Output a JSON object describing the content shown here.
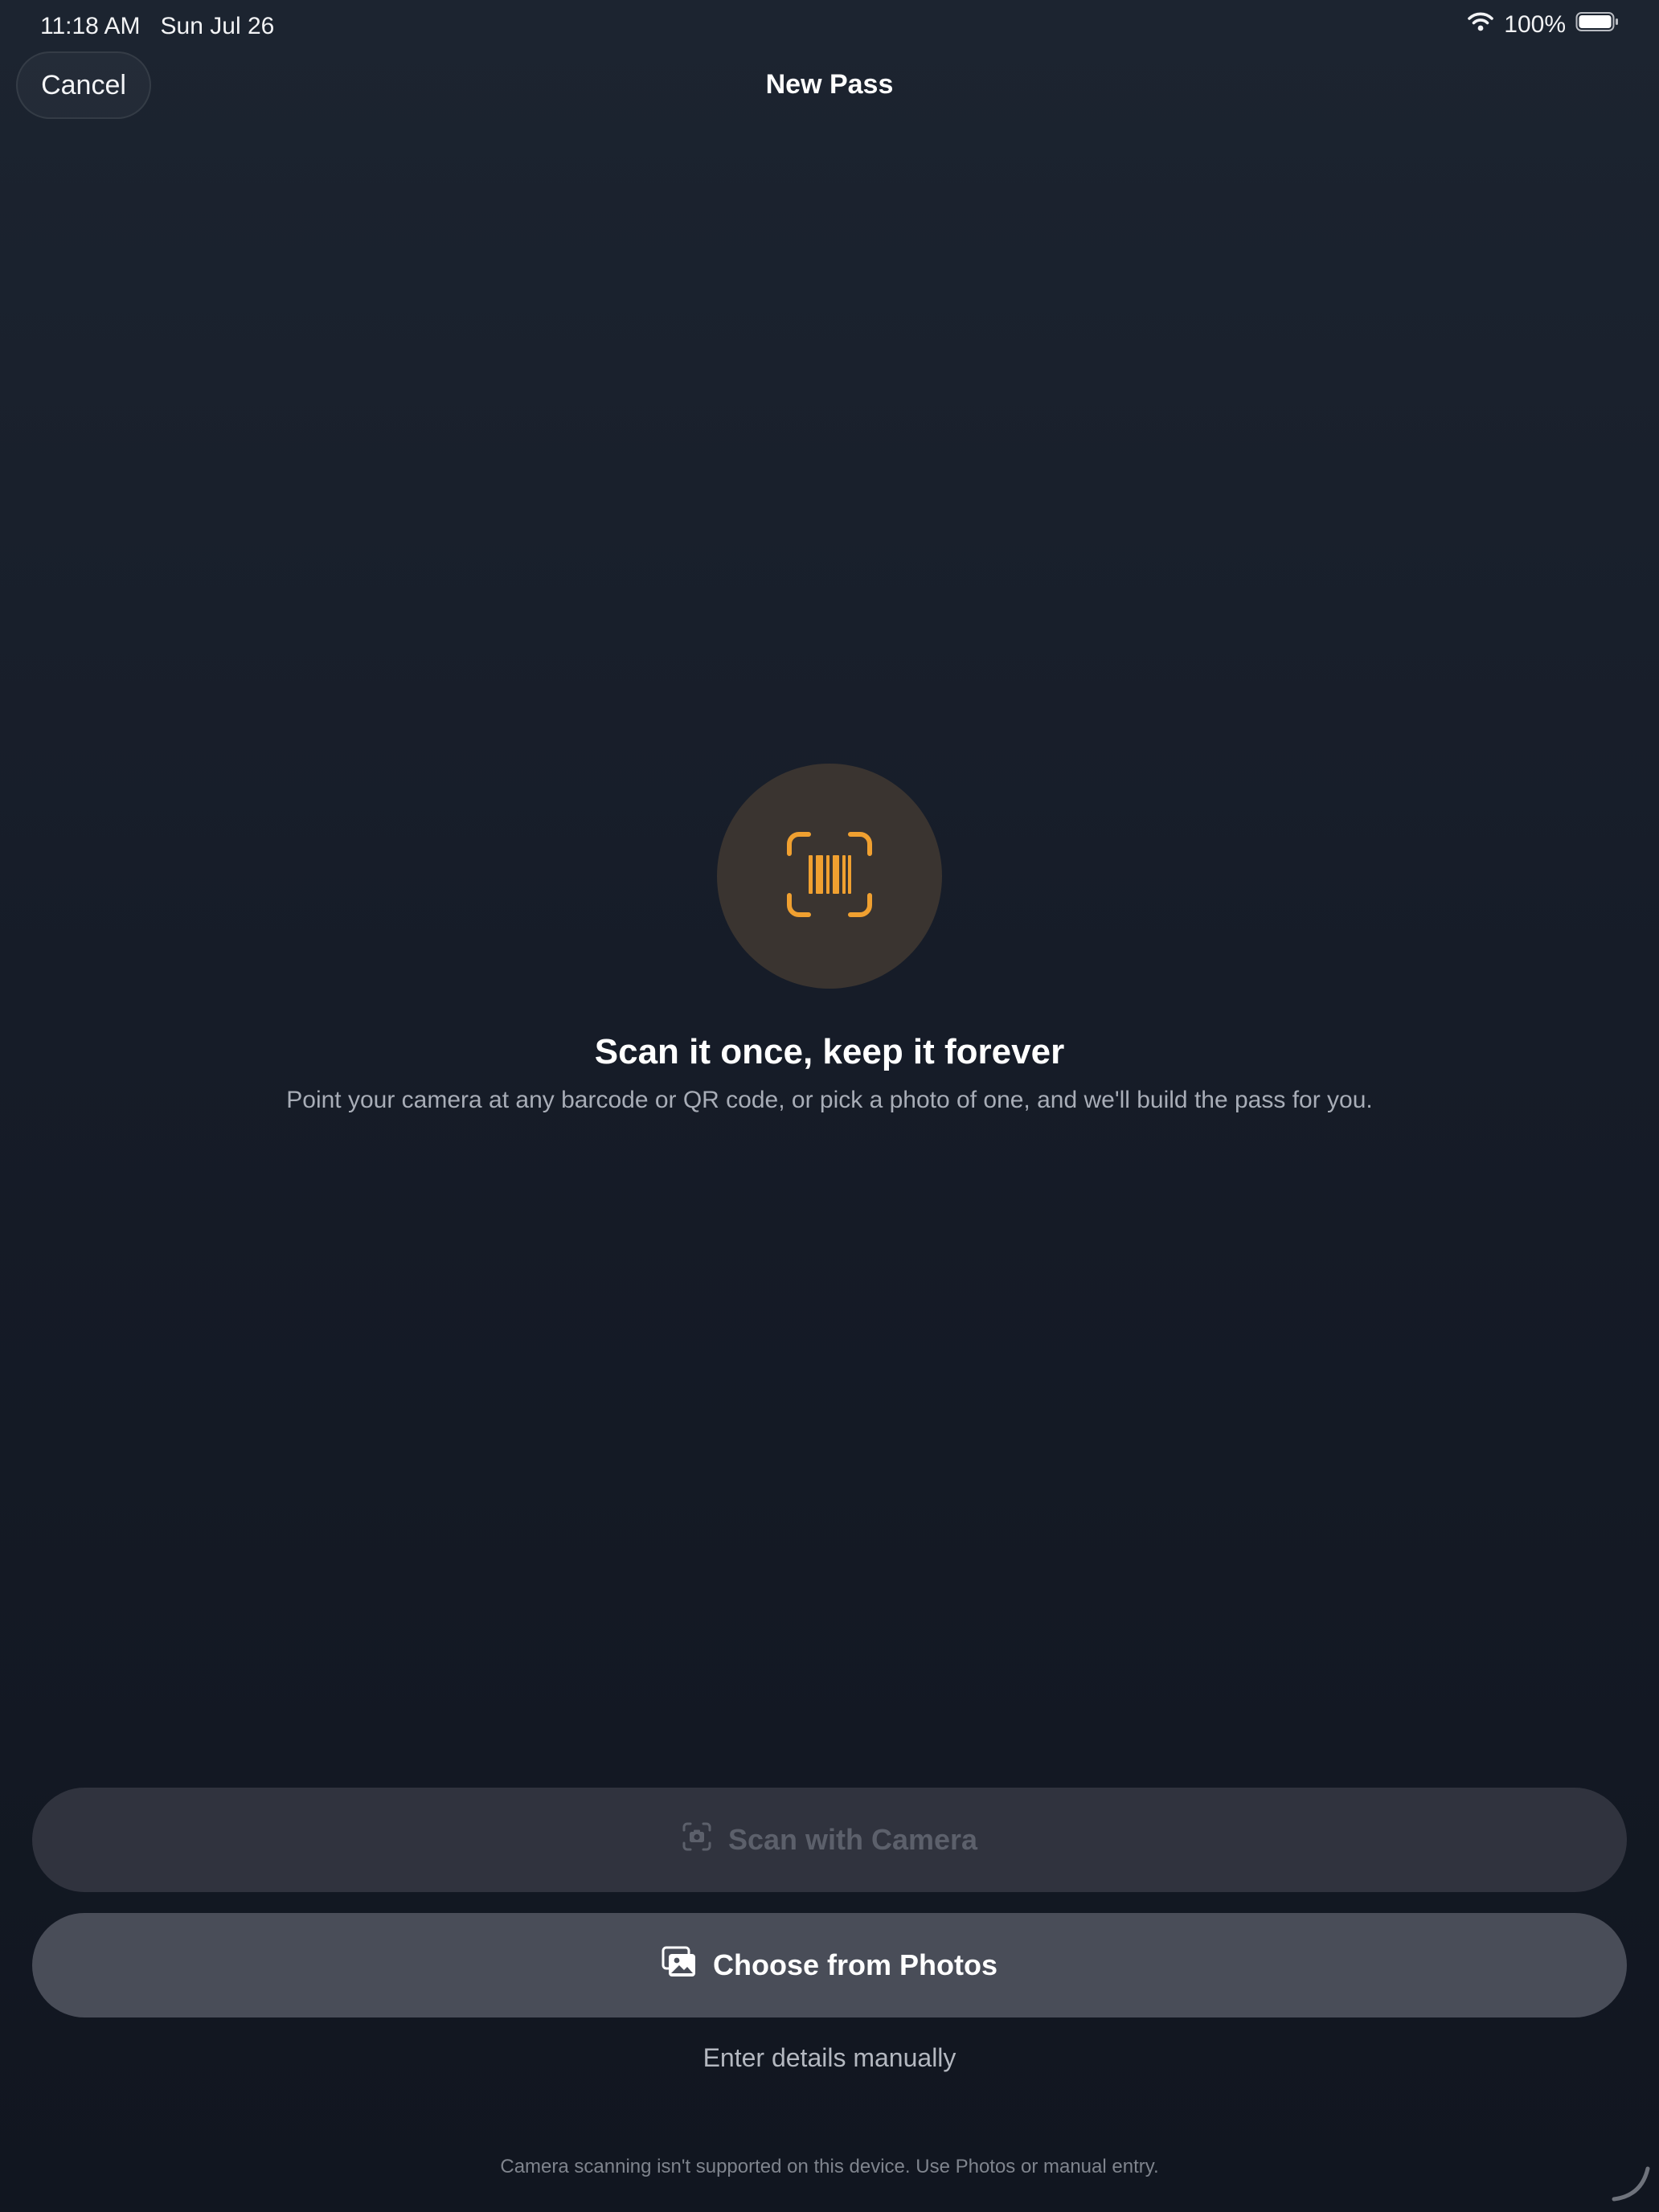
{
  "status_bar": {
    "time": "11:18 AM",
    "date": "Sun Jul 26",
    "battery_percent": "100%",
    "icons": [
      "wifi-icon",
      "battery-icon"
    ]
  },
  "nav": {
    "cancel_label": "Cancel",
    "title": "New Pass"
  },
  "hero": {
    "icon": "barcode-scan-icon",
    "title": "Scan it once, keep it forever",
    "subtitle": "Point your camera at any barcode or QR code, or pick a photo of one, and we'll build the pass for you."
  },
  "actions": {
    "scan_camera_label": "Scan with Camera",
    "scan_camera_icon": "camera-viewfinder-icon",
    "scan_camera_disabled": true,
    "choose_photos_label": "Choose from Photos",
    "choose_photos_icon": "photos-icon",
    "manual_label": "Enter details manually"
  },
  "footer": {
    "note": "Camera scanning isn't supported on this device. Use Photos or manual entry."
  },
  "colors": {
    "accent": "#f0a030",
    "background_top": "#1c2430",
    "background_bottom": "#111620"
  }
}
